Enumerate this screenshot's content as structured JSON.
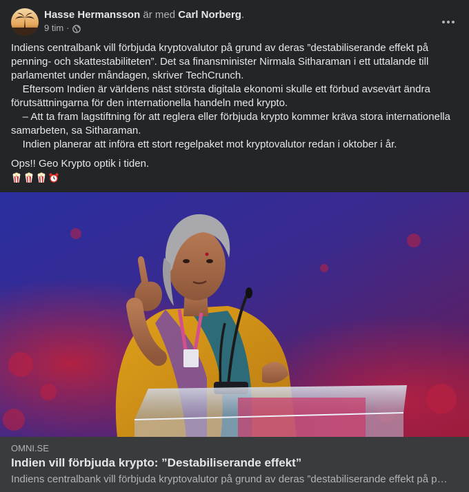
{
  "post": {
    "author": "Hasse Hermansson",
    "with_text": "är med",
    "tagged": "Carl Norberg",
    "trailing": ".",
    "time": "9 tim",
    "separator": "·",
    "audience_icon": "globe-icon",
    "more_icon": "more-horizontal-icon",
    "paragraphs": [
      "Indiens centralbank vill förbjuda kryptovalutor på grund av deras ”destabiliserande effekt på penning- och skattestabiliteten”. Det sa finansminister Nirmala Sitharaman i ett uttalande till parlamentet under måndagen, skriver TechCrunch.",
      "    Eftersom Indien är världens näst största digitala ekonomi skulle ett förbud avsevärt ändra förutsättningarna för den internationella handeln med krypto.",
      "    – Att ta fram lagstiftning för att reglera eller förbjuda krypto kommer kräva stora internationella samarbeten, sa Sitharaman.",
      "    Indien planerar att införa ett stort regelpaket mot kryptovalutor redan i oktober i år."
    ],
    "comment": "Ops!! Geo Krypto optik i tiden.",
    "emoji_icons": [
      "popcorn-icon",
      "popcorn-icon",
      "popcorn-icon",
      "alarm-clock-icon"
    ]
  },
  "link": {
    "domain": "OMNI.SE",
    "title": "Indien vill förbjuda krypto: ”Destabiliserande effekt”",
    "description": "Indiens centralbank vill förbjuda kryptovalutor på grund av deras ”destabiliserande effekt på penning- och skattestabiliteten”. Det sa finansminister Nirmala Sitharaman"
  },
  "colors": {
    "card_bg": "#242526",
    "link_bg": "#3a3b3c",
    "primary_text": "#e4e6eb",
    "secondary_text": "#b0b3b8"
  }
}
